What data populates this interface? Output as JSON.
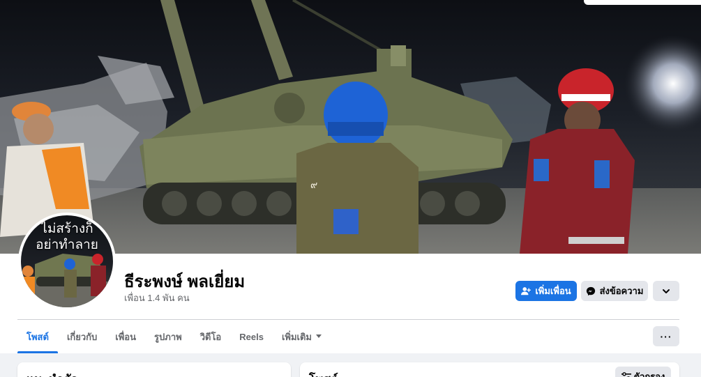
{
  "cover": {
    "description_icon": "cover-photo"
  },
  "avatar": {
    "caption_line1": "ไม่สร้างก็",
    "caption_line2": "อย่าทำลาย"
  },
  "profile": {
    "name": "ธีระพงษ์ พลเยี่ยม",
    "friends": "เพื่อน 1.4 พัน คน"
  },
  "actions": {
    "add_friend": "เพิ่มเพื่อน",
    "message": "ส่งข้อความ",
    "add_friend_icon": "add-friend-icon",
    "messenger_icon": "messenger-icon",
    "dropdown_icon": "chevron-down-icon"
  },
  "tabs": [
    {
      "label": "โพสต์",
      "active": true
    },
    {
      "label": "เกี่ยวกับ",
      "active": false
    },
    {
      "label": "เพื่อน",
      "active": false
    },
    {
      "label": "รูปภาพ",
      "active": false
    },
    {
      "label": "วิดีโอ",
      "active": false
    },
    {
      "label": "Reels",
      "active": false
    },
    {
      "label": "เพิ่มเติม",
      "active": false
    }
  ],
  "tab_more_button": "···",
  "intro_card": {
    "title": "แนะนำตัว"
  },
  "posts_card": {
    "title": "โพสต์",
    "filter_label": "ตัวกรอง"
  },
  "colors": {
    "accent": "#1b74e4",
    "secondary_button": "#e4e6eb",
    "muted_text": "#65676b",
    "page_background": "#f0f2f5"
  }
}
